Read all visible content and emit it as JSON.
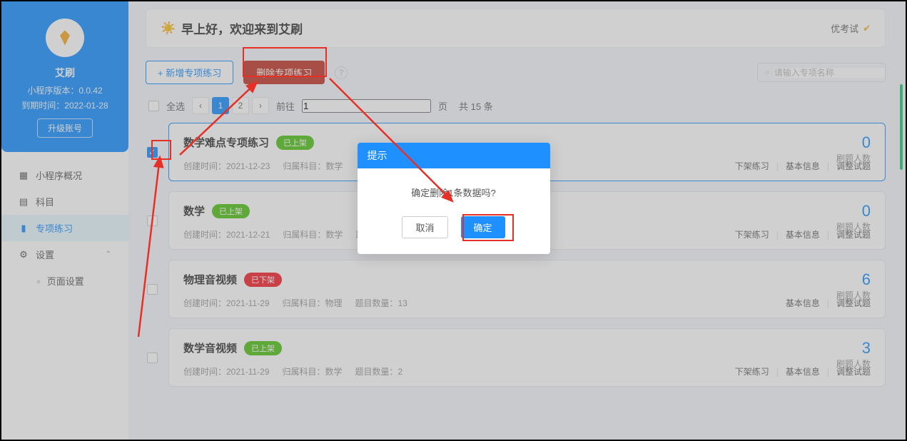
{
  "sidebar": {
    "appName": "艾刷",
    "version": "小程序版本：0.0.42",
    "expiry": "到期时间：2022-01-28",
    "upgrade": "升级账号",
    "nav": {
      "overview": "小程序概况",
      "subject": "科目",
      "practice": "专项练习",
      "settings": "设置",
      "pageSettings": "页面设置"
    }
  },
  "header": {
    "greeting": "早上好，欢迎来到艾刷",
    "examTitle": "优考试"
  },
  "toolbar": {
    "add": "+ 新增专项练习",
    "delete": "删除专项练习",
    "searchPlaceholder": "请输入专项名称"
  },
  "listHeader": {
    "selectAll": "全选",
    "goto": "前往",
    "gotoValue": "1",
    "page": "页",
    "total": "共 15 条",
    "pages": [
      "1",
      "2"
    ]
  },
  "items": [
    {
      "title": "数学难点专项练习",
      "badge": "已上架",
      "badgeOn": true,
      "created": "创建时间：2021-12-23",
      "subject": "归属科目：数学",
      "qcount": "",
      "count": "0",
      "countLabel": "刷题人数",
      "actions": [
        "下架练习",
        "基本信息",
        "调整试题"
      ],
      "checked": true
    },
    {
      "title": "数学",
      "badge": "已上架",
      "badgeOn": true,
      "created": "创建时间：2021-12-21",
      "subject": "归属科目：数学",
      "qcount": "题目数量：0",
      "count": "0",
      "countLabel": "刷题人数",
      "actions": [
        "下架练习",
        "基本信息",
        "调整试题"
      ],
      "checked": false
    },
    {
      "title": "物理音视频",
      "badge": "已下架",
      "badgeOn": false,
      "created": "创建时间：2021-11-29",
      "subject": "归属科目：物理",
      "qcount": "题目数量：13",
      "count": "6",
      "countLabel": "刷题人数",
      "actions": [
        "基本信息",
        "调整试题"
      ],
      "checked": false
    },
    {
      "title": "数学音视频",
      "badge": "已上架",
      "badgeOn": true,
      "created": "创建时间：2021-11-29",
      "subject": "归属科目：数学",
      "qcount": "题目数量：2",
      "count": "3",
      "countLabel": "刷题人数",
      "actions": [
        "下架练习",
        "基本信息",
        "调整试题"
      ],
      "checked": false
    }
  ],
  "dialog": {
    "title": "提示",
    "message": "确定删除1条数据吗?",
    "cancel": "取消",
    "ok": "确定"
  }
}
